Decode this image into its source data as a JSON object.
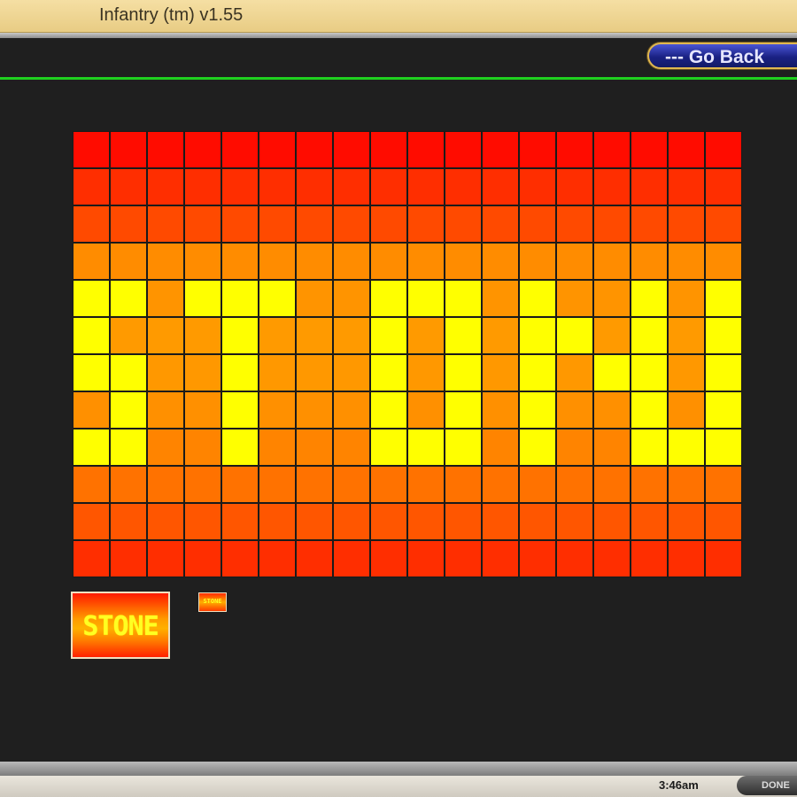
{
  "window": {
    "title": "Infantry (tm) v1.55"
  },
  "toolbar": {
    "go_back_label": "--- Go Back"
  },
  "tile_grid": {
    "columns": 18,
    "rows": 12,
    "row_colors": [
      "#ff0c00",
      "#ff2e00",
      "#ff4a00",
      "#ff8c00",
      "#ff9400",
      "#ff9a00",
      "#ff9800",
      "#ff9000",
      "#ff8400",
      "#ff7200",
      "#ff5600",
      "#ff2e00"
    ],
    "highlight_color": "#ffff00",
    "highlight_mask": [
      "000000000000000000",
      "000000000000000000",
      "000000000000000000",
      "000000000000000000",
      "110111001110100101",
      "100010001010110101",
      "110010001010101101",
      "010010001010100101",
      "110010001110100111",
      "000000000000000000",
      "000000000000000000",
      "000000000000000000"
    ]
  },
  "previews": {
    "large_label": "STONE",
    "small_label": "STONE"
  },
  "status": {
    "clock": "3:46am",
    "done_label": "DONE"
  }
}
